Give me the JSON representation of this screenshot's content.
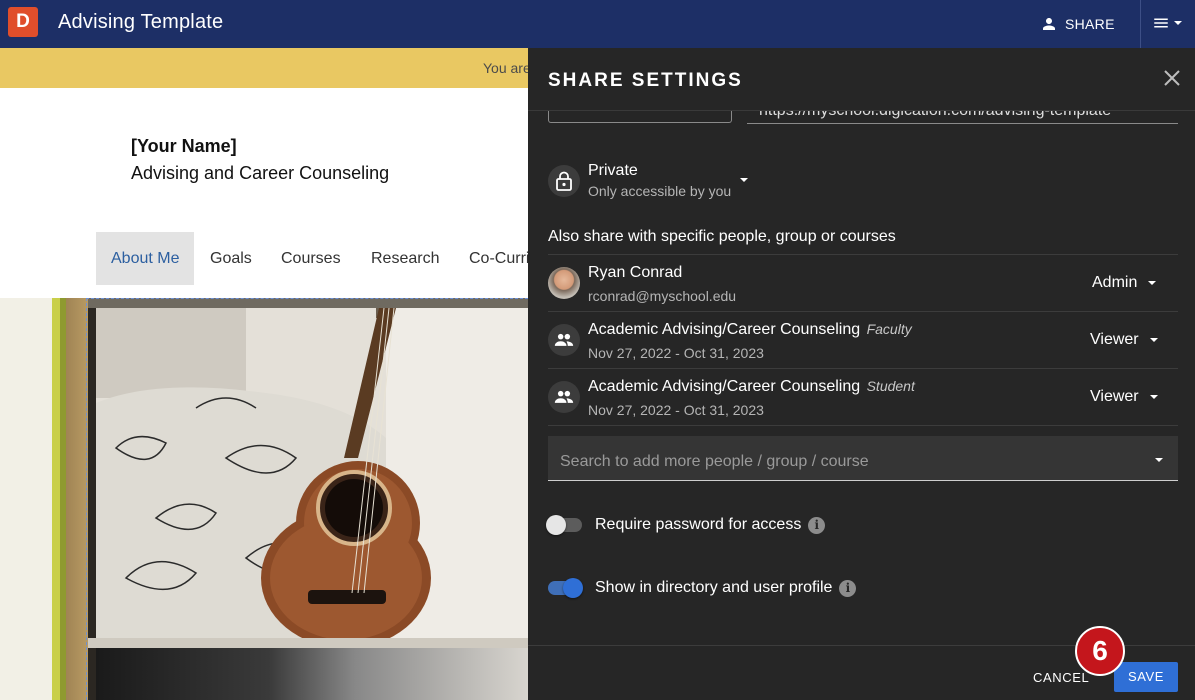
{
  "appbar": {
    "logo_letter": "D",
    "title": "Advising Template",
    "share_label": "SHARE",
    "icons": {
      "person": "person-icon",
      "menu": "hamburger-menu-icon",
      "caret": "caret-down-icon"
    }
  },
  "background_page": {
    "banner_text": "You are",
    "name": "[Your Name]",
    "subtitle": "Advising and Career Counseling",
    "tabs": [
      {
        "label": "About Me",
        "active": true
      },
      {
        "label": "Goals"
      },
      {
        "label": "Courses"
      },
      {
        "label": "Research"
      },
      {
        "label": "Co-Curri"
      }
    ]
  },
  "share_panel": {
    "title": "SHARE SETTINGS",
    "url_fragment": "https://myschool.digication.com/advising-template",
    "privacy": {
      "label": "Private",
      "sub": "Only accessible by you",
      "icon": "lock-icon"
    },
    "also_share_label": "Also share with specific people, group or courses",
    "entries": [
      {
        "name": "Ryan Conrad",
        "tag": "",
        "sub": "rconrad@myschool.edu",
        "role": "Admin",
        "icon": "avatar"
      },
      {
        "name": "Academic Advising/Career Counseling",
        "tag": "Faculty",
        "sub": "Nov 27, 2022 - Oct 31, 2023",
        "role": "Viewer",
        "icon": "group-icon"
      },
      {
        "name": "Academic Advising/Career Counseling",
        "tag": "Student",
        "sub": "Nov 27, 2022 - Oct 31, 2023",
        "role": "Viewer",
        "icon": "group-icon"
      }
    ],
    "search_placeholder": "Search to add more people / group / course",
    "toggles": [
      {
        "label": "Require password for access",
        "on": false
      },
      {
        "label": "Show in directory and user profile",
        "on": true
      }
    ],
    "cancel_label": "CANCEL",
    "save_label": "SAVE"
  },
  "step_badge": "6",
  "colors": {
    "appbar": "#1d2f66",
    "panel": "#262626",
    "banner": "#e9c862",
    "accent": "#2f6fd6",
    "active_tab_text": "#2c5fa0",
    "badge": "#c4161c"
  }
}
